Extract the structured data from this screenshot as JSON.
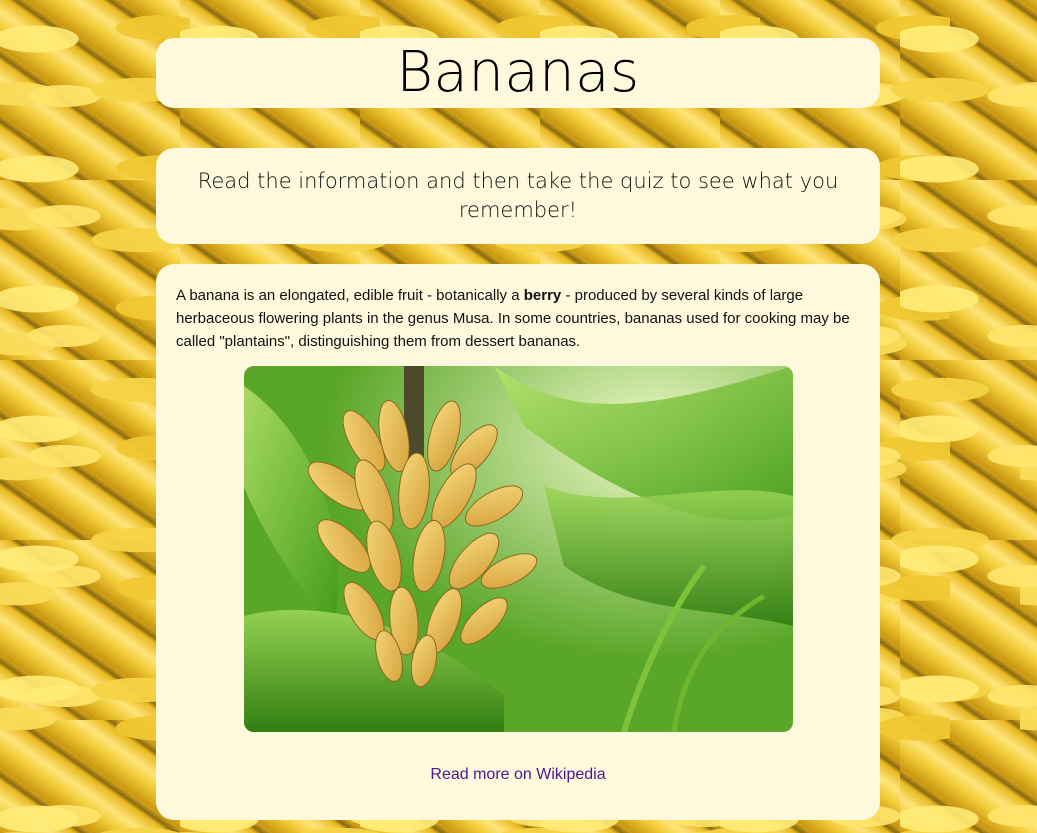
{
  "page": {
    "title": "Bananas",
    "intro": "Read the information and then take the quiz to see what you remember!"
  },
  "content": {
    "text_before_bold": "A banana is an elongated, edible fruit - botanically a ",
    "bold_word": "berry",
    "text_after_bold": " - produced by several kinds of large herbaceous flowering plants in the genus Musa. In some countries, bananas used for cooking may be called \"plantains\", distinguishing them from dessert bananas.",
    "image_icon": "banana-bunch-photo",
    "link_label": "Read more on Wikipedia"
  },
  "colors": {
    "card_background": "#fef9dc",
    "link": "#4a178f",
    "background_banana": "#e6b521"
  }
}
